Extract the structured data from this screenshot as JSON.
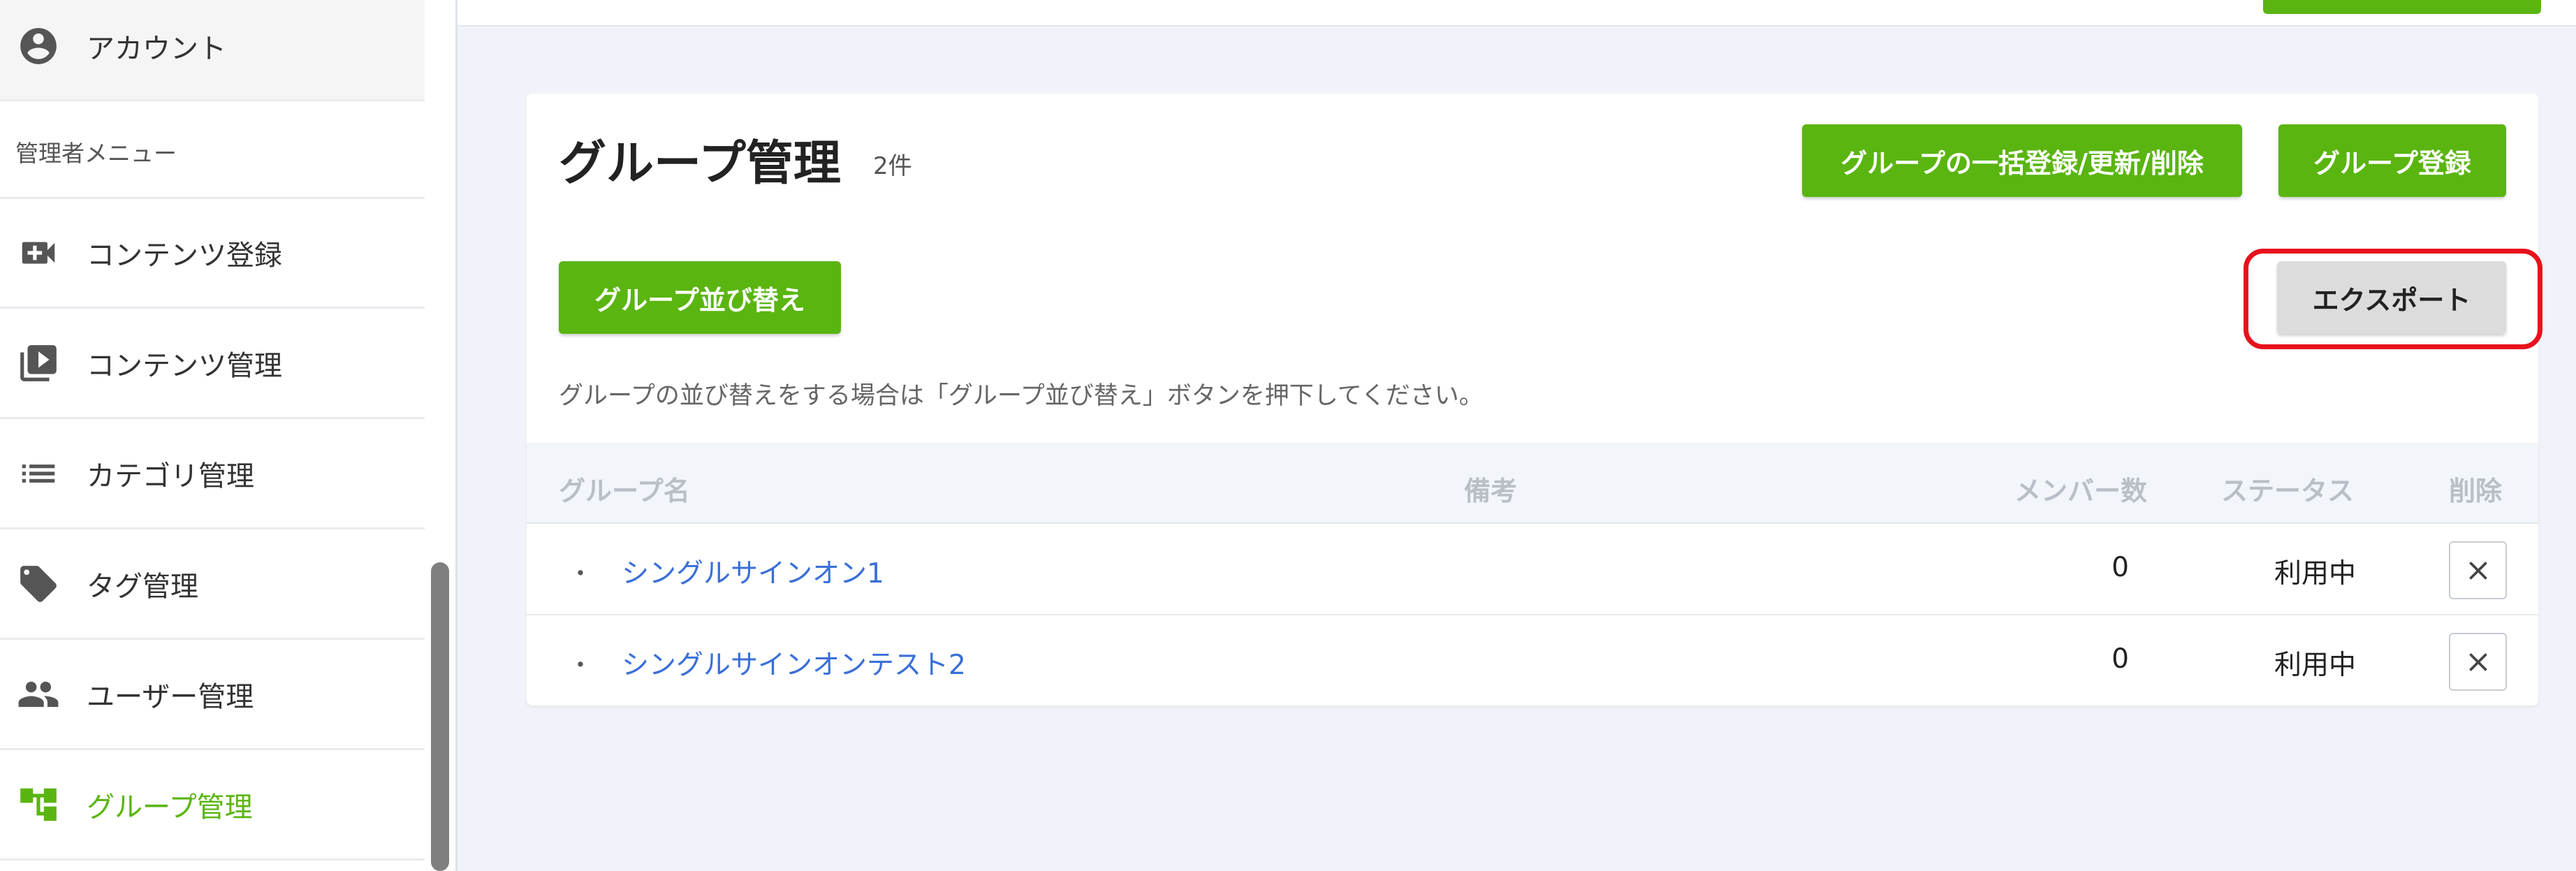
{
  "sidebar": {
    "account_label": "アカウント",
    "section_label": "管理者メニュー",
    "items": [
      {
        "label": "コンテンツ登録",
        "icon": "video-add-icon"
      },
      {
        "label": "コンテンツ管理",
        "icon": "playlist-play-icon"
      },
      {
        "label": "カテゴリ管理",
        "icon": "list-icon"
      },
      {
        "label": "タグ管理",
        "icon": "tag-icon"
      },
      {
        "label": "ユーザー管理",
        "icon": "people-icon"
      },
      {
        "label": "グループ管理",
        "icon": "group-tree-icon",
        "active": true
      }
    ]
  },
  "main": {
    "title": "グループ管理",
    "count": "2件",
    "bulk_button": "グループの一括登録/更新/削除",
    "register_button": "グループ登録",
    "sort_button": "グループ並び替え",
    "export_button": "エクスポート",
    "hint": "グループの並び替えをする場合は「グループ並び替え」ボタンを押下してください。",
    "table": {
      "headers": {
        "name": "グループ名",
        "note": "備考",
        "members": "メンバー数",
        "status": "ステータス",
        "delete": "削除"
      },
      "rows": [
        {
          "bullet": "・",
          "name": "シングルサインオン1",
          "note": "",
          "members": "0",
          "status": "利用中"
        },
        {
          "bullet": "・",
          "name": "シングルサインオンテスト2",
          "note": "",
          "members": "0",
          "status": "利用中"
        }
      ]
    }
  },
  "colors": {
    "accent_green": "#5ab510",
    "link_blue": "#3a6fd8",
    "highlight_red": "#e8101c"
  }
}
